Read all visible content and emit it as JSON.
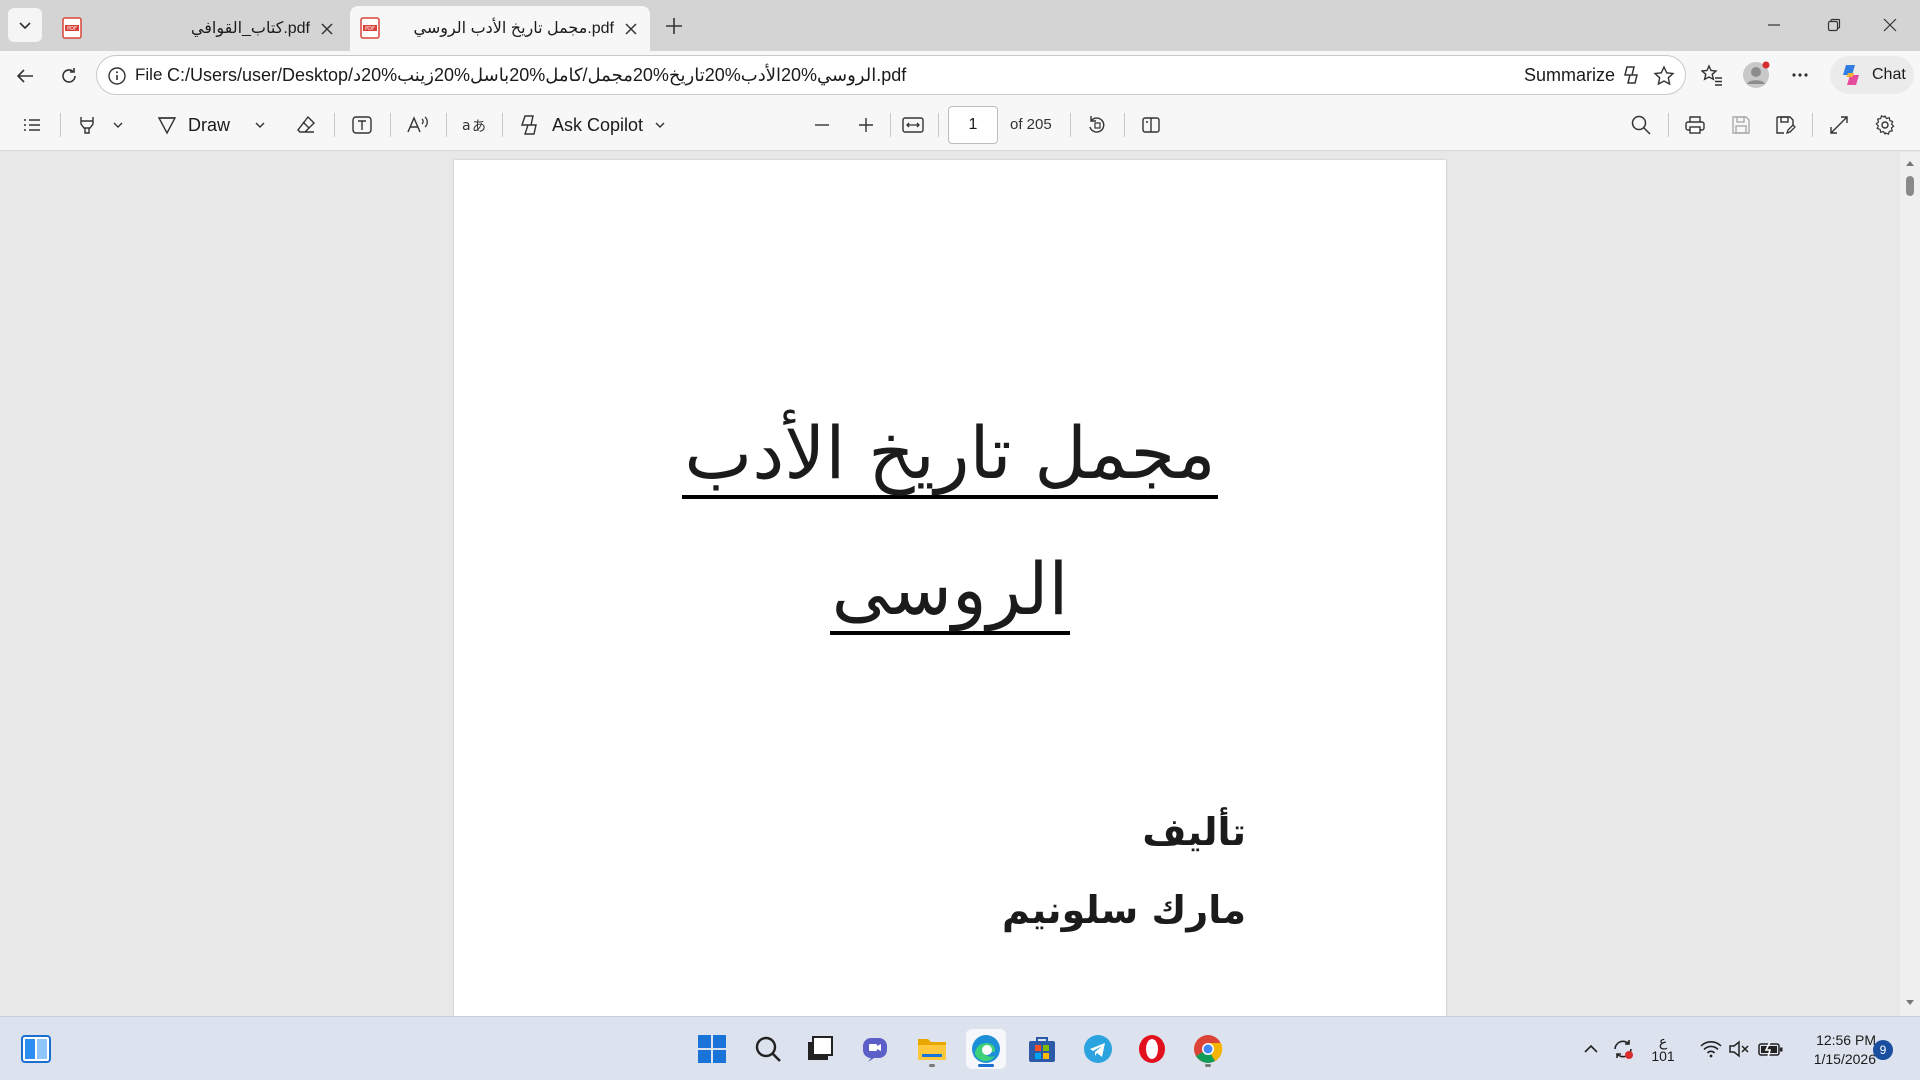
{
  "tabs": [
    {
      "title": "كتاب_القوافي.pdf",
      "active": false
    },
    {
      "title": "مجمل تاريخ الأدب الروسي.pdf",
      "active": true
    }
  ],
  "address_bar": {
    "scheme_label": "File",
    "url": "C:/Users/user/Desktop/الروسي%20الأدب%20تاريخ%20مجمل/كامل%20باسل%20زينب%20د.pdf",
    "summarize_label": "Summarize",
    "chat_label": "Chat"
  },
  "pdf_toolbar": {
    "draw_label": "Draw",
    "ask_copilot_label": "Ask Copilot",
    "current_page": "1",
    "page_total_label": "of 205"
  },
  "document": {
    "title_line1": "مجمل تاريخ الأدب",
    "title_line2": "الروسى",
    "author_label": "تأليف",
    "author_name": "مارك سلونيم"
  },
  "taskbar": {
    "language_indicator": "ع",
    "language_sub": "101",
    "time": "12:56 PM",
    "date": "1/15/2026",
    "notification_count": "9"
  },
  "colors": {
    "edge_accent": "#1a6fd1",
    "pdf_badge": "#d9443a",
    "taskbar_bg": "#dde3ee"
  }
}
